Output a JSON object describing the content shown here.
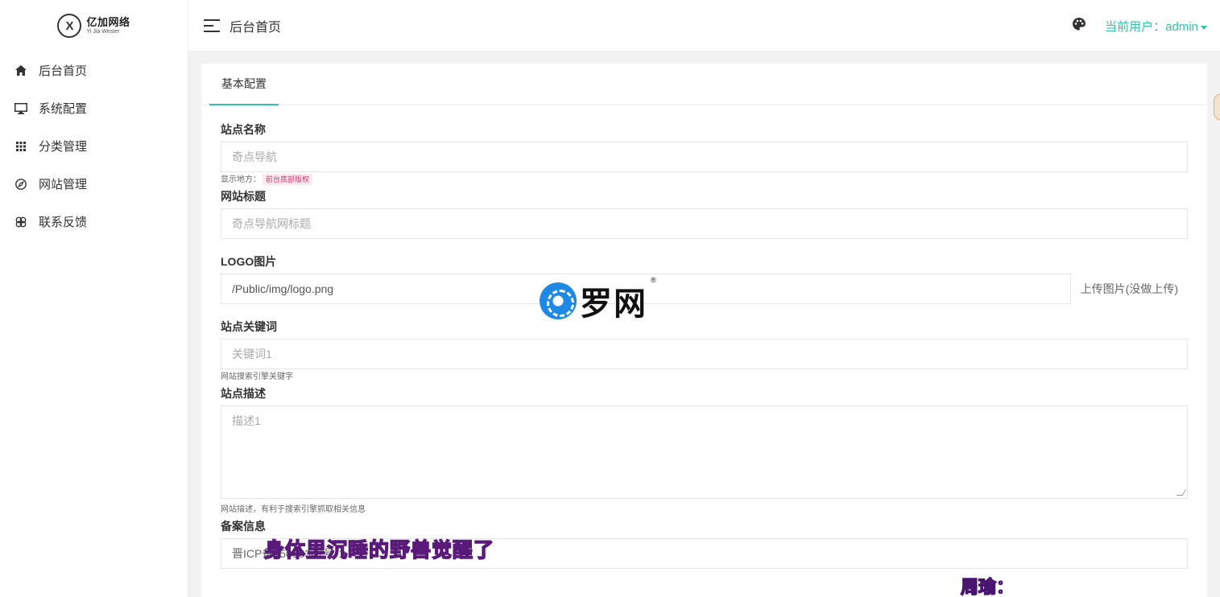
{
  "brand": {
    "mark": "X",
    "name_cn": "亿加网络",
    "name_en": "Yi Jia Wester"
  },
  "sidebar": {
    "items": [
      {
        "label": "后台首页",
        "icon": "home-icon"
      },
      {
        "label": "系统配置",
        "icon": "monitor-icon"
      },
      {
        "label": "分类管理",
        "icon": "grid-icon"
      },
      {
        "label": "网站管理",
        "icon": "compass-icon"
      },
      {
        "label": "联系反馈",
        "icon": "link-icon"
      }
    ]
  },
  "header": {
    "title": "后台首页",
    "user_label": "当前用户：admin"
  },
  "card": {
    "tab": "基本配置"
  },
  "form": {
    "site_name": {
      "label": "站点名称",
      "placeholder": "奇点导航",
      "hint_prefix": "显示地方：",
      "hint_tag": "前台底部版权"
    },
    "site_title": {
      "label": "网站标题",
      "placeholder": "奇点导航网标题"
    },
    "logo": {
      "label": "LOGO图片",
      "value": "/Public/img/logo.png",
      "upload_label": "上传图片(没做上传)"
    },
    "keywords": {
      "label": "站点关键词",
      "placeholder": "关键词1",
      "hint": "网站搜索引擎关键字"
    },
    "description": {
      "label": "站点描述",
      "placeholder": "描述1",
      "hint": "网站描述，有利于搜索引擎抓取相关信息"
    },
    "icp": {
      "label": "备案信息",
      "value": "晋ICP备15006347号-1"
    }
  },
  "overlay": {
    "watermark": "罗网",
    "watermark_reg": "®",
    "subtitle": "身体里沉睡的野兽觉醒了",
    "speaker": "周瑜："
  },
  "colors": {
    "accent": "#2ec4a6",
    "tag_text": "#e0336b",
    "tag_bg": "#fde9ef"
  }
}
